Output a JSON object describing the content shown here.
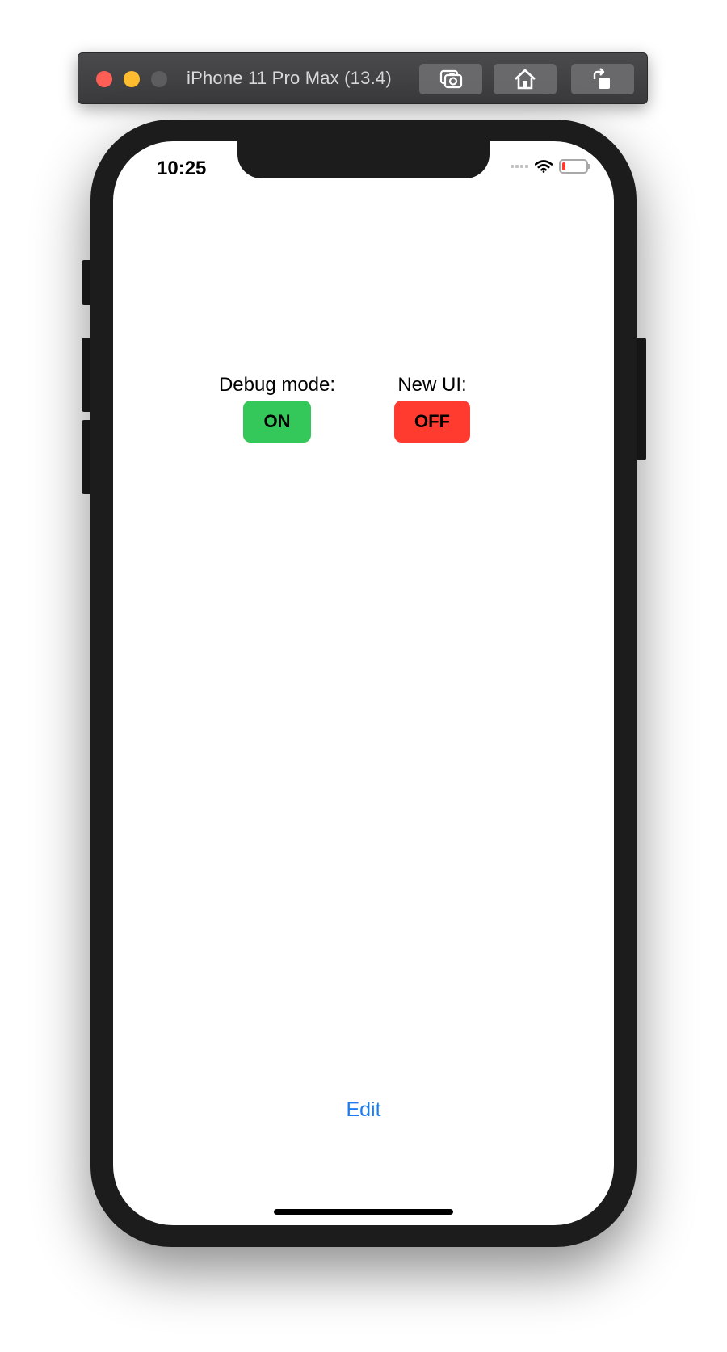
{
  "simulator": {
    "title": "iPhone 11 Pro Max (13.4)",
    "buttons": [
      {
        "icon": "screenshot-icon"
      },
      {
        "icon": "home-icon"
      },
      {
        "icon": "rotate-icon"
      }
    ]
  },
  "status_bar": {
    "time": "10:25",
    "battery_level": 0.15,
    "battery_color": "#ff3b30"
  },
  "app": {
    "toggles": [
      {
        "label": "Debug mode:",
        "state": "ON",
        "color": "#34c759"
      },
      {
        "label": "New UI:",
        "state": "OFF",
        "color": "#ff3b30"
      }
    ],
    "edit_label": "Edit",
    "accent_color": "#1a7cf5"
  }
}
